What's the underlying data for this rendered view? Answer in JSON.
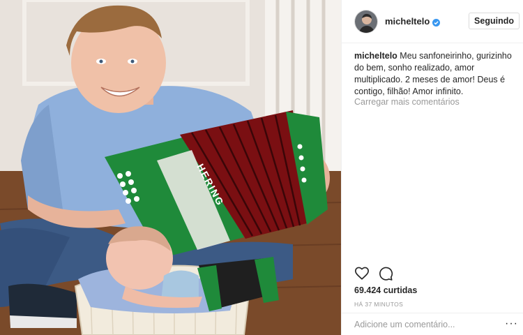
{
  "post": {
    "username": "micheltelo",
    "follow_label": "Seguindo",
    "caption_user": "micheltelo",
    "caption_text": " Meu sanfoneirinho, gurizinho do bem, sonho realizado, amor multiplicado. 2 meses de amor! Deus é contigo, filhão! Amor infinito.",
    "load_more": "Carregar mais comentários",
    "likes": "69.424 curtidas",
    "time_ago": "HÁ 37 MINUTOS",
    "comment_placeholder": "Adicione um comentário...",
    "more_options": "···"
  },
  "photo": {
    "accordion_brand": "HERING"
  },
  "icons": {
    "verified": "verified-badge-icon",
    "like": "heart-outline-icon",
    "comment": "speech-bubble-icon",
    "options": "ellipsis-icon"
  },
  "colors": {
    "verified": "#3897f0",
    "accordion_green": "#1f8a3a",
    "accordion_red": "#7a0f12",
    "shirt": "#8fb0dc"
  }
}
